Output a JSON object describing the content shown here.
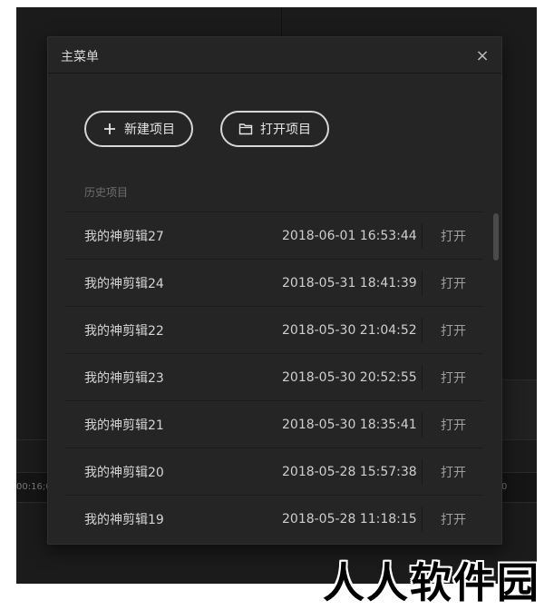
{
  "background_app": {
    "ruler_left_text": "00:16;0",
    "ruler_right_text": "0"
  },
  "modal": {
    "title": "主菜单",
    "close_glyph": "×",
    "new_project_label": "新建项目",
    "open_project_label": "打开项目",
    "history_label": "历史项目",
    "history": [
      {
        "name": "我的神剪辑27",
        "time": "2018-06-01 16:53:44",
        "action": "打开"
      },
      {
        "name": "我的神剪辑24",
        "time": "2018-05-31 18:41:39",
        "action": "打开"
      },
      {
        "name": "我的神剪辑22",
        "time": "2018-05-30 21:04:52",
        "action": "打开"
      },
      {
        "name": "我的神剪辑23",
        "time": "2018-05-30 20:52:55",
        "action": "打开"
      },
      {
        "name": "我的神剪辑21",
        "time": "2018-05-30 18:35:41",
        "action": "打开"
      },
      {
        "name": "我的神剪辑20",
        "time": "2018-05-28 15:57:38",
        "action": "打开"
      },
      {
        "name": "我的神剪辑19",
        "time": "2018-05-28 11:18:15",
        "action": "打开"
      }
    ]
  },
  "watermark": "人人软件园",
  "icons": {
    "new_project": "plus-icon",
    "open_project": "folder-icon",
    "close": "close-icon"
  },
  "colors": {
    "modal_bg": "#252525",
    "app_bg": "#1b1b1b",
    "text": "#d4d4d4",
    "muted": "#6e6e6e"
  }
}
